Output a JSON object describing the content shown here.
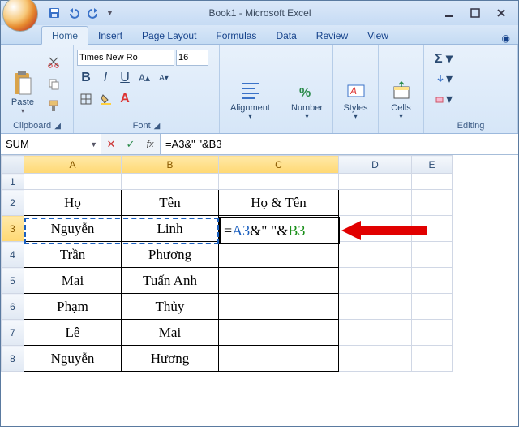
{
  "window": {
    "title": "Book1 - Microsoft Excel"
  },
  "tabs": {
    "home": "Home",
    "insert": "Insert",
    "pageLayout": "Page Layout",
    "formulas": "Formulas",
    "data": "Data",
    "review": "Review",
    "view": "View"
  },
  "ribbon": {
    "clipboard": {
      "label": "Clipboard",
      "paste": "Paste"
    },
    "font": {
      "label": "Font",
      "family": "Times New Ro",
      "size": "16"
    },
    "alignment": {
      "label": "Alignment"
    },
    "number": {
      "label": "Number"
    },
    "styles": {
      "label": "Styles"
    },
    "cells": {
      "label": "Cells"
    },
    "editing": {
      "label": "Editing"
    }
  },
  "namebox": "SUM",
  "formula": "=A3&\" \"&B3",
  "columns": [
    "A",
    "B",
    "C",
    "D",
    "E"
  ],
  "rows": [
    "1",
    "2",
    "3",
    "4",
    "5",
    "6",
    "7",
    "8"
  ],
  "cells": {
    "A2": "Họ",
    "B2": "Tên",
    "C2": "Họ & Tên",
    "A3": "Nguyễn",
    "B3": "Linh",
    "A4": "Trần",
    "B4": "Phương",
    "A5": "Mai",
    "B5": "Tuấn Anh",
    "A6": "Phạm",
    "B6": "Thủy",
    "A7": "Lê",
    "B7": "Mai",
    "A8": "Nguyễn",
    "B8": "Hương"
  },
  "editing": {
    "cell": "C3",
    "display_parts": {
      "eq": "=",
      "r1": "A3",
      "amp1": "&\" \"&",
      "r2": "B3"
    }
  }
}
